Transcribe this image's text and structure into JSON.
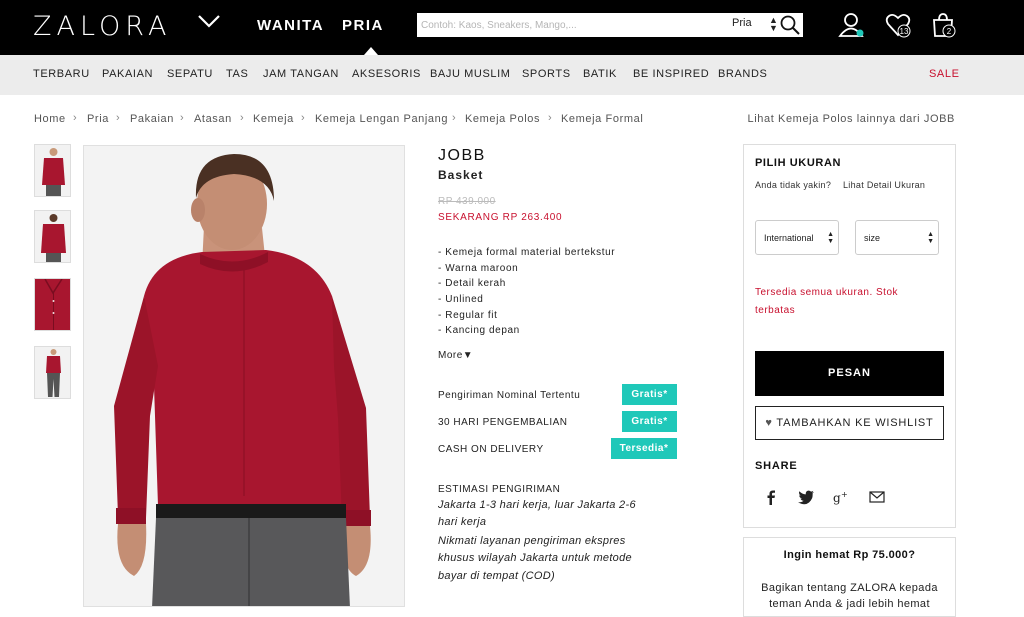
{
  "header": {
    "logo": "ZALORA",
    "gender_tabs": [
      "WANITA",
      "PRIA"
    ],
    "search": {
      "placeholder": "Contoh: Kaos, Sneakers, Mango,...",
      "scope": "Pria"
    },
    "icons": [
      "account-icon",
      "wishlist-icon",
      "cart-icon"
    ],
    "wishlist_count": "13",
    "cart_count": "2"
  },
  "categories": [
    "TERBARU",
    "PAKAIAN",
    "SEPATU",
    "TAS",
    "JAM TANGAN",
    "AKSESORIS",
    "BAJU MUSLIM",
    "SPORTS",
    "BATIK",
    "BE INSPIRED",
    "BRANDS",
    "SALE"
  ],
  "breadcrumb": [
    "Home",
    "Pria",
    "Pakaian",
    "Atasan",
    "Kemeja",
    "Kemeja Lengan Panjang",
    "Kemeja Polos",
    "Kemeja Formal"
  ],
  "breadcrumb_right": "Lihat Kemeja Polos lainnya dari JOBB",
  "product": {
    "brand": "JOBB",
    "name": "Basket",
    "old_price": "RP 439.000",
    "price": "SEKARANG RP 263.400",
    "features": [
      "- Kemeja formal material bertekstur",
      "- Warna maroon",
      "- Detail kerah",
      "- Unlined",
      "- Regular fit",
      "- Kancing depan"
    ],
    "more": "More▼",
    "services": [
      {
        "label": "Pengiriman Nominal Tertentu",
        "badge": "Gratis*"
      },
      {
        "label": "30 HARI PENGEMBALIAN",
        "badge": "Gratis*"
      },
      {
        "label": "CASH ON DELIVERY",
        "badge": "Tersedia*"
      }
    ],
    "estimate_title": "ESTIMASI PENGIRIMAN",
    "estimate_lines": [
      "Jakarta 1-3 hari kerja, luar Jakarta 2-6",
      "hari kerja",
      "Nikmati layanan pengiriman ekspres",
      "khusus wilayah Jakarta untuk metode",
      "bayar di tempat (COD)"
    ]
  },
  "size_panel": {
    "title": "PILIH UKURAN",
    "help_question": "Anda tidak yakin?",
    "help_link": "Lihat Detail Ukuran",
    "system_select": "International",
    "size_select": "size",
    "stock_lines": [
      "Tersedia semua ukuran. Stok",
      "terbatas"
    ],
    "order_button": "PESAN",
    "wishlist_button": "TAMBAHKAN KE WISHLIST",
    "share_title": "SHARE",
    "share_icons": [
      "facebook-icon",
      "twitter-icon",
      "google-plus-icon",
      "email-icon"
    ]
  },
  "promo": {
    "title": "Ingin hemat Rp 75.000?",
    "lines": [
      "Bagikan tentang ZALORA kepada",
      "teman Anda & jadi lebih hemat"
    ]
  },
  "colors": {
    "accent_red": "#c8102e",
    "badge_teal": "#1fc8b9",
    "shirt": "#a8162f"
  }
}
